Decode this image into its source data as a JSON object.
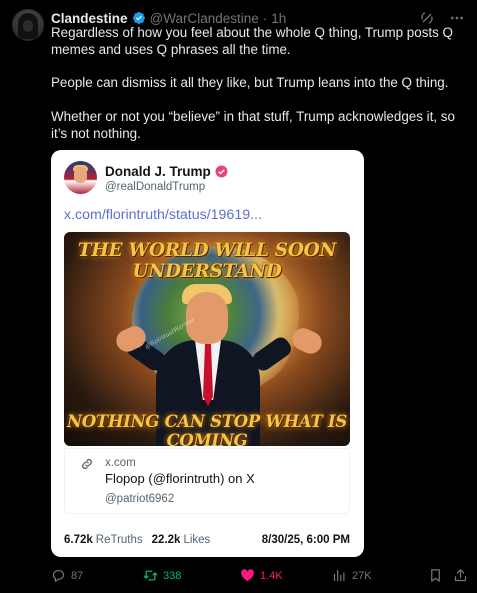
{
  "author": {
    "name": "Clandestine",
    "handle": "@WarClandestine",
    "separator": "·",
    "time": "1h"
  },
  "tweet": {
    "paragraphs": [
      "Regardless of how you feel about the whole Q thing, Trump posts Q memes and uses Q phrases all the time.",
      "People can dismiss it all they like, but Trump leans into the Q thing.",
      "Whether or not you “believe” in that stuff, Trump acknowledges it, so it’s not nothing."
    ]
  },
  "quoted": {
    "name": "Donald J. Trump",
    "handle": "@realDonaldTrump",
    "link_text": "x.com/florintruth/status/19619...",
    "image": {
      "top_text": "THE WORLD WILL SOON UNDERSTAND",
      "bottom_text": "NOTHING CAN STOP WHAT IS COMING",
      "signature": "@SpiritualWarrior"
    },
    "card": {
      "domain": "x.com",
      "title": "Flopop (@florintruth) on X",
      "subtitle": "@patriot6962"
    },
    "stats": {
      "retruths_count": "6.72k",
      "retruths_label": "ReTruths",
      "likes_count": "22.2k",
      "likes_label": "Likes",
      "date": "8/30/25, 6:00 PM"
    }
  },
  "actions": {
    "replies": "87",
    "reposts": "338",
    "likes": "1.4K",
    "views": "27K"
  },
  "colors": {
    "background": "#000000",
    "verified_blue": "#1d9bf0",
    "repost_green": "#00ba7c",
    "like_pink": "#f91880",
    "link_blue": "#5b6fd6",
    "truth_badge_pink": "#e5457b"
  },
  "icons": {
    "verified": "verified-badge-icon",
    "grok": "grok-icon",
    "more": "more-dots-icon",
    "reply": "reply-icon",
    "repost": "repost-icon",
    "like": "heart-icon",
    "views": "views-chart-icon",
    "bookmark": "bookmark-icon",
    "share": "share-icon",
    "link": "link-icon"
  }
}
